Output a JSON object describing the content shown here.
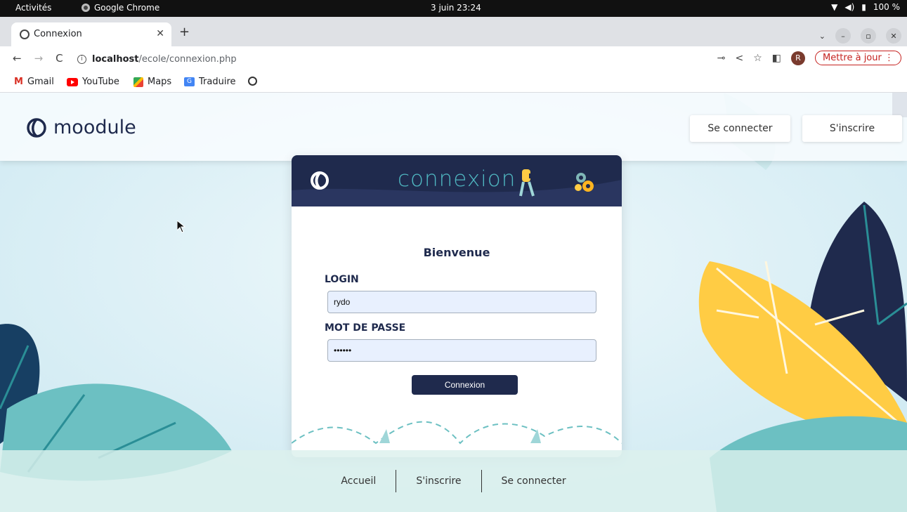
{
  "os": {
    "activities": "Activités",
    "app_name": "Google Chrome",
    "clock": "3 juin  23:24",
    "battery": "100 %"
  },
  "browser": {
    "tab_title": "Connexion",
    "url_host": "localhost",
    "url_path": "/ecole/connexion.php",
    "profile_initial": "R",
    "update_label": "Mettre à jour",
    "bookmarks": [
      "Gmail",
      "YouTube",
      "Maps",
      "Traduire"
    ]
  },
  "page": {
    "logo_text": "moodule",
    "nav_login": "Se connecter",
    "nav_signup": "S'inscrire",
    "card_title": "connexion",
    "welcome": "Bienvenue",
    "login_label": "LOGIN",
    "login_value": "rydo",
    "password_label": "MOT DE PASSE",
    "password_value": "••••••",
    "submit_label": "Connexion",
    "footer_links": [
      "Accueil",
      "S'inscrire",
      "Se connecter"
    ]
  },
  "colors": {
    "navy": "#1f2a4d",
    "teal": "#4fb6c0",
    "yellow": "#ffcc44",
    "update_red": "#c5221f"
  }
}
